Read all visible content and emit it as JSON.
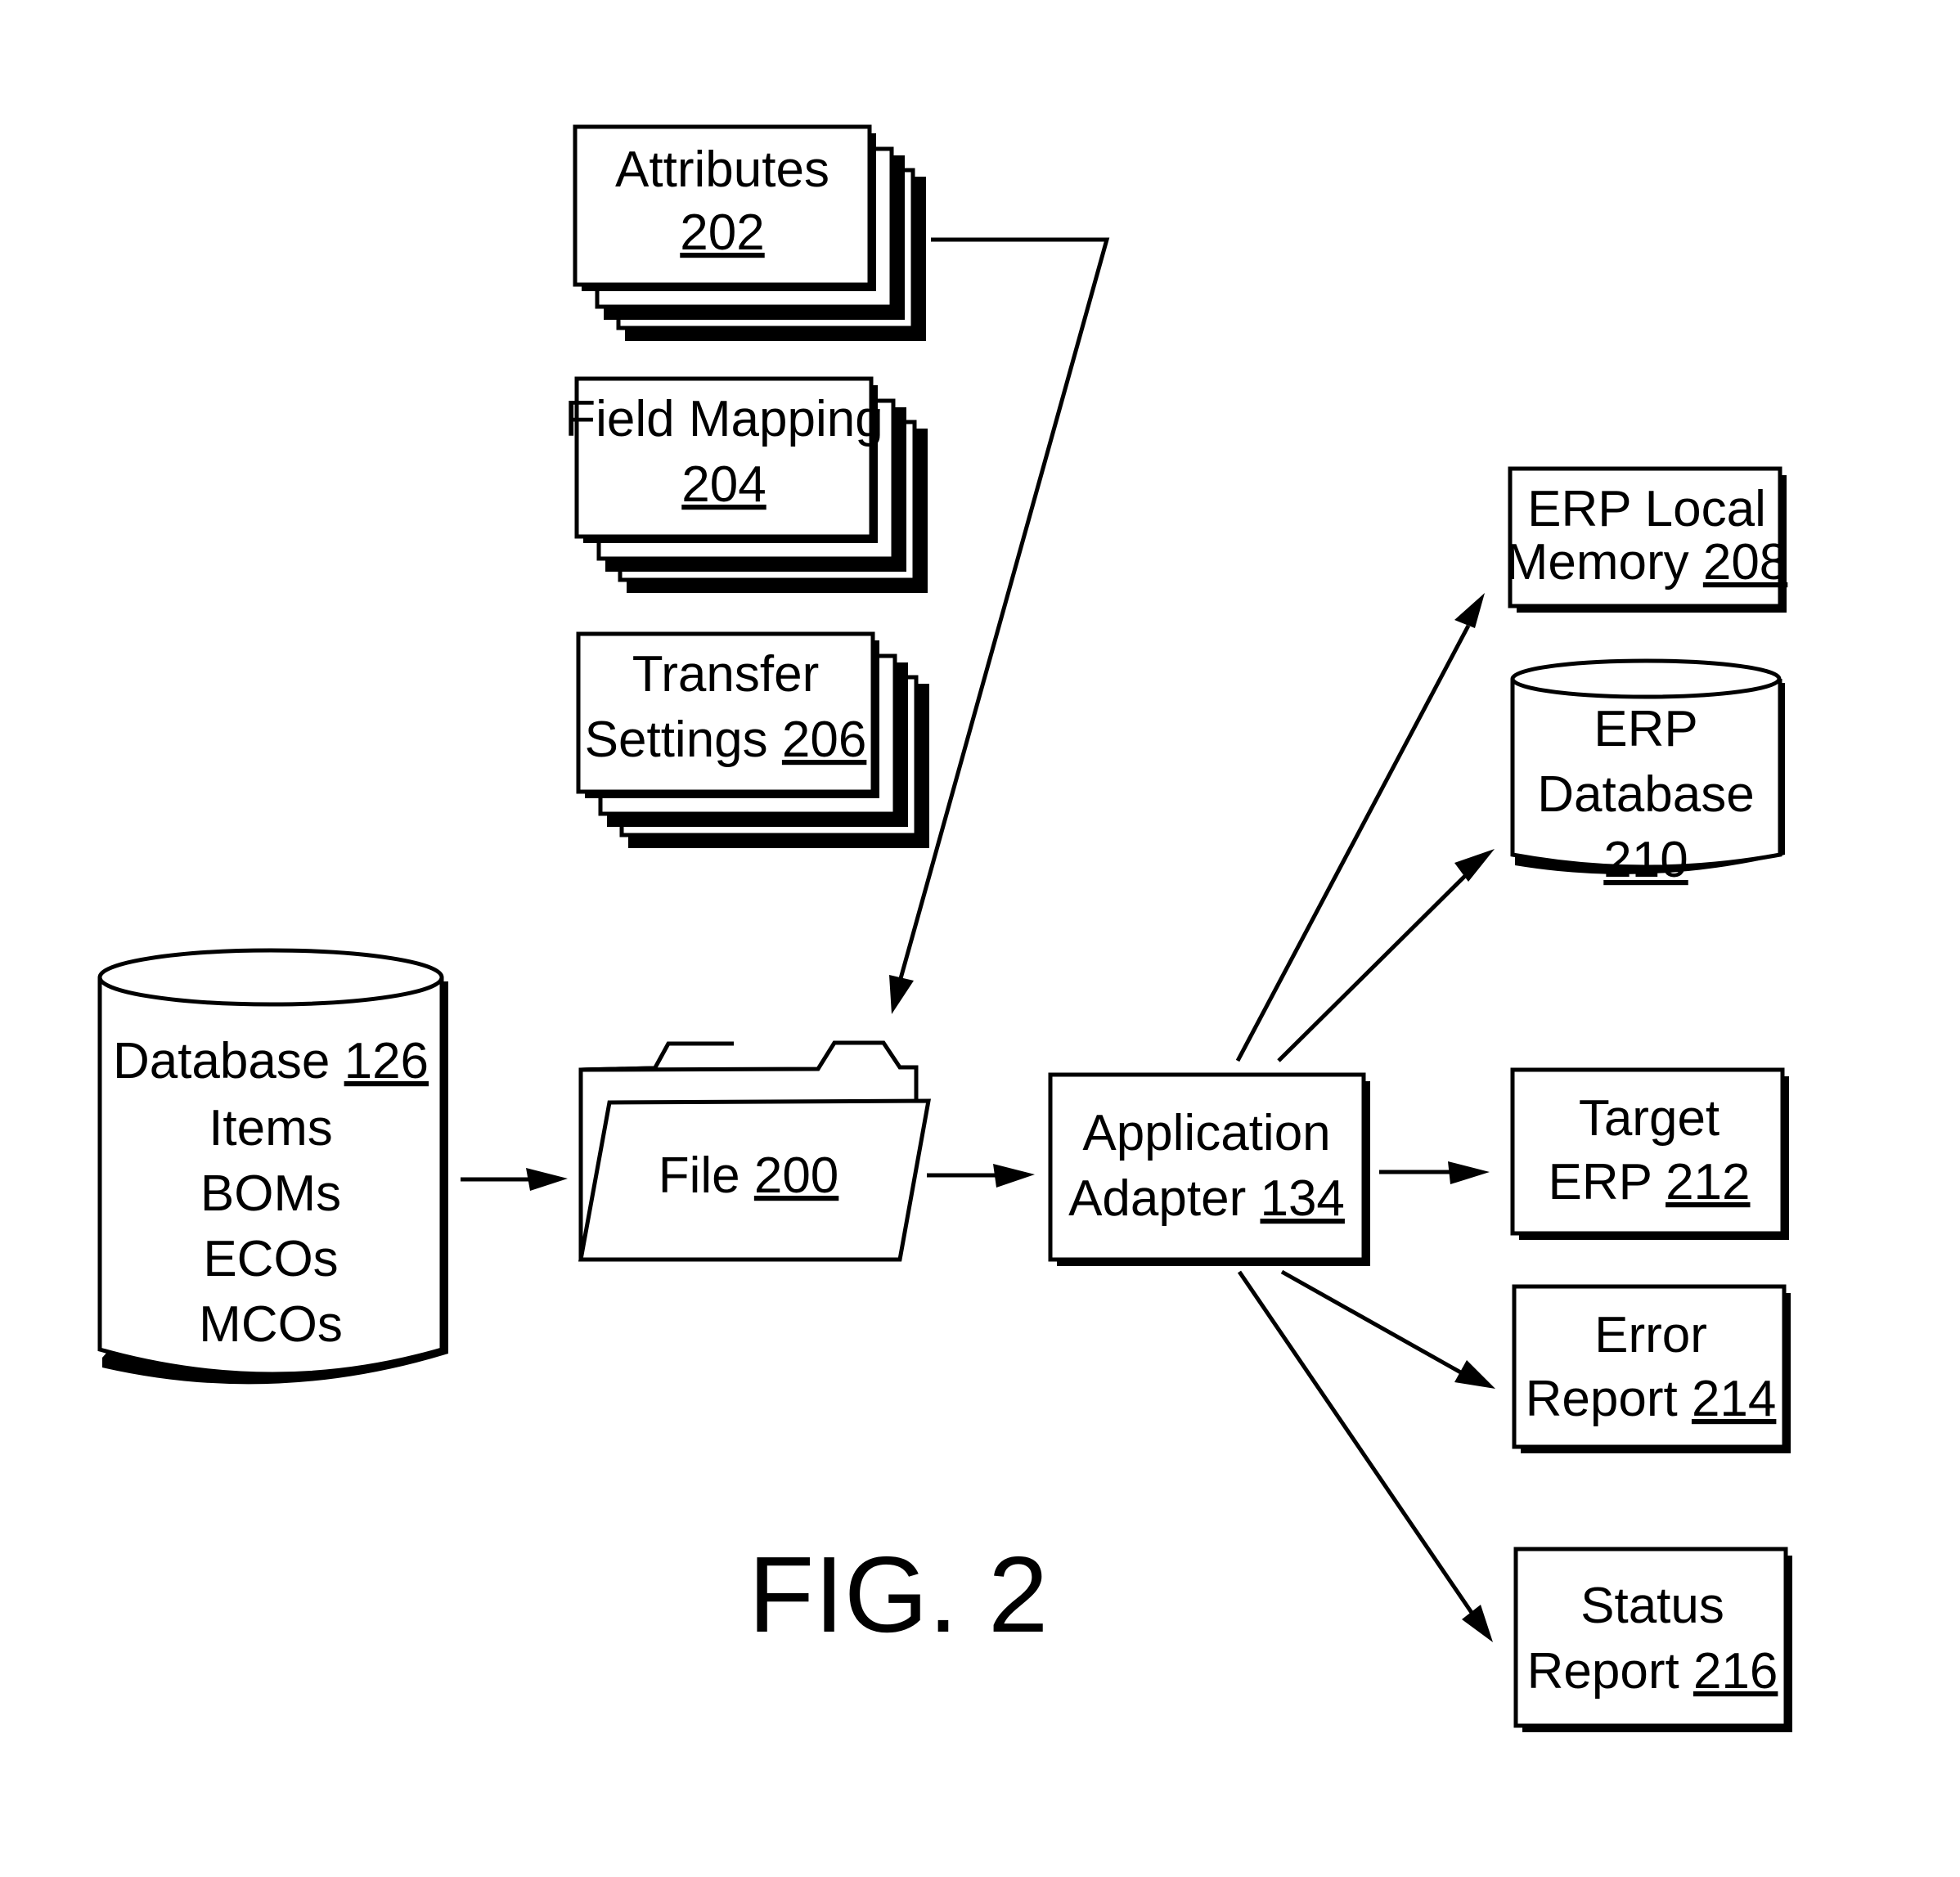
{
  "figure": {
    "caption": "FIG. 2",
    "colors": {
      "ink": "#000000",
      "paper": "#ffffff"
    }
  },
  "nodes": {
    "attributes": {
      "shape": "stacked-sheets",
      "lines": [
        [
          "Attributes",
          ""
        ],
        [
          "",
          "202"
        ]
      ]
    },
    "field_mapping": {
      "shape": "stacked-sheets",
      "lines": [
        [
          "Field Mapping",
          ""
        ],
        [
          "",
          "204"
        ]
      ]
    },
    "transfer_settings": {
      "shape": "stacked-sheets",
      "lines": [
        [
          "Transfer",
          ""
        ],
        [
          "Settings ",
          "206"
        ]
      ]
    },
    "database": {
      "shape": "cylinder",
      "lines": [
        [
          "Database ",
          "126"
        ],
        [
          "Items",
          ""
        ],
        [
          "BOMs",
          ""
        ],
        [
          "ECOs",
          ""
        ],
        [
          "MCOs",
          ""
        ]
      ]
    },
    "file": {
      "shape": "folder",
      "lines": [
        [
          "File ",
          "200"
        ]
      ]
    },
    "adapter": {
      "shape": "box",
      "lines": [
        [
          "Application",
          ""
        ],
        [
          "Adapter ",
          "134"
        ]
      ]
    },
    "erp_local_memory": {
      "shape": "box",
      "lines": [
        [
          "ERP Local",
          ""
        ],
        [
          "Memory ",
          "208"
        ]
      ]
    },
    "erp_database": {
      "shape": "cylinder",
      "lines": [
        [
          "ERP",
          ""
        ],
        [
          "Database",
          ""
        ],
        [
          "",
          "210"
        ]
      ]
    },
    "target_erp": {
      "shape": "box",
      "lines": [
        [
          "Target",
          ""
        ],
        [
          "ERP ",
          "212"
        ]
      ]
    },
    "error_report": {
      "shape": "box",
      "lines": [
        [
          "Error",
          ""
        ],
        [
          "Report ",
          "214"
        ]
      ]
    },
    "status_report": {
      "shape": "box",
      "lines": [
        [
          "Status",
          ""
        ],
        [
          "Report ",
          "216"
        ]
      ]
    }
  },
  "edges": [
    {
      "from": "attributes",
      "to": "file"
    },
    {
      "from": "database",
      "to": "file"
    },
    {
      "from": "file",
      "to": "adapter"
    },
    {
      "from": "adapter",
      "to": "erp_local_memory"
    },
    {
      "from": "adapter",
      "to": "erp_database"
    },
    {
      "from": "adapter",
      "to": "target_erp"
    },
    {
      "from": "adapter",
      "to": "error_report"
    },
    {
      "from": "adapter",
      "to": "status_report"
    }
  ]
}
